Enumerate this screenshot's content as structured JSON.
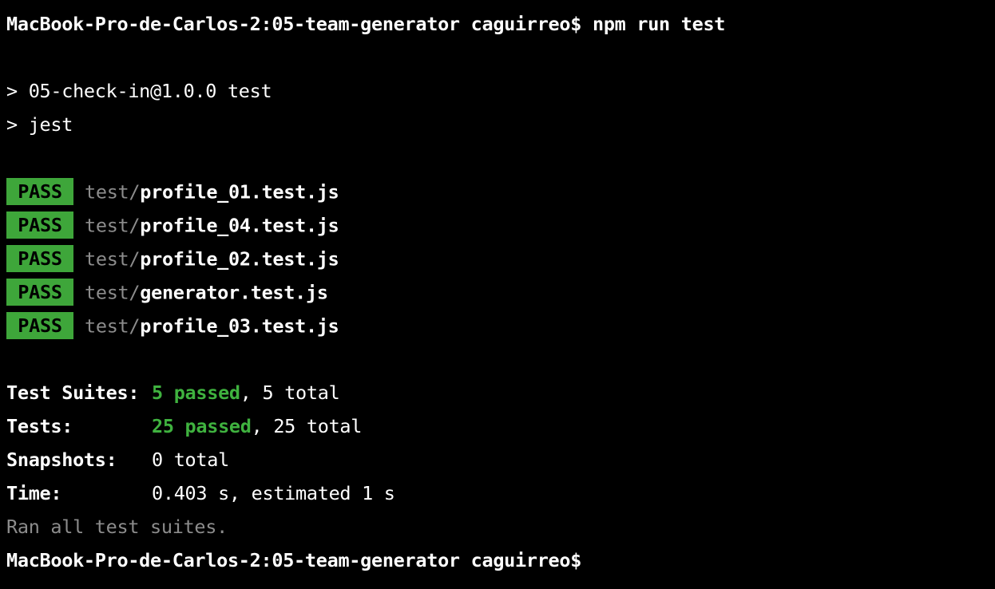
{
  "terminal": {
    "prompt": "MacBook-Pro-de-Carlos-2:05-team-generator caguirreo$",
    "command": "npm run test",
    "script_header": "> 05-check-in@1.0.0 test",
    "script_cmd": "> jest",
    "pass_label": "PASS",
    "test_dir": "test/",
    "test_files": [
      "profile_01.test.js",
      "profile_04.test.js",
      "profile_02.test.js",
      "generator.test.js",
      "profile_03.test.js"
    ],
    "summary": {
      "suites_label": "Test Suites:",
      "suites_passed": "5 passed",
      "suites_total": ", 5 total",
      "tests_label": "Tests:",
      "tests_passed": "25 passed",
      "tests_total": ", 25 total",
      "snapshots_label": "Snapshots:",
      "snapshots_value": "0 total",
      "time_label": "Time:",
      "time_value": "0.403 s, estimated 1 s"
    },
    "ran_all": "Ran all test suites.",
    "final_prompt": "MacBook-Pro-de-Carlos-2:05-team-generator caguirreo$"
  },
  "colors": {
    "background": "#000000",
    "pass_badge": "#3ea63a",
    "passed_text": "#3fb23f",
    "dim_text": "#8c8c8c"
  }
}
